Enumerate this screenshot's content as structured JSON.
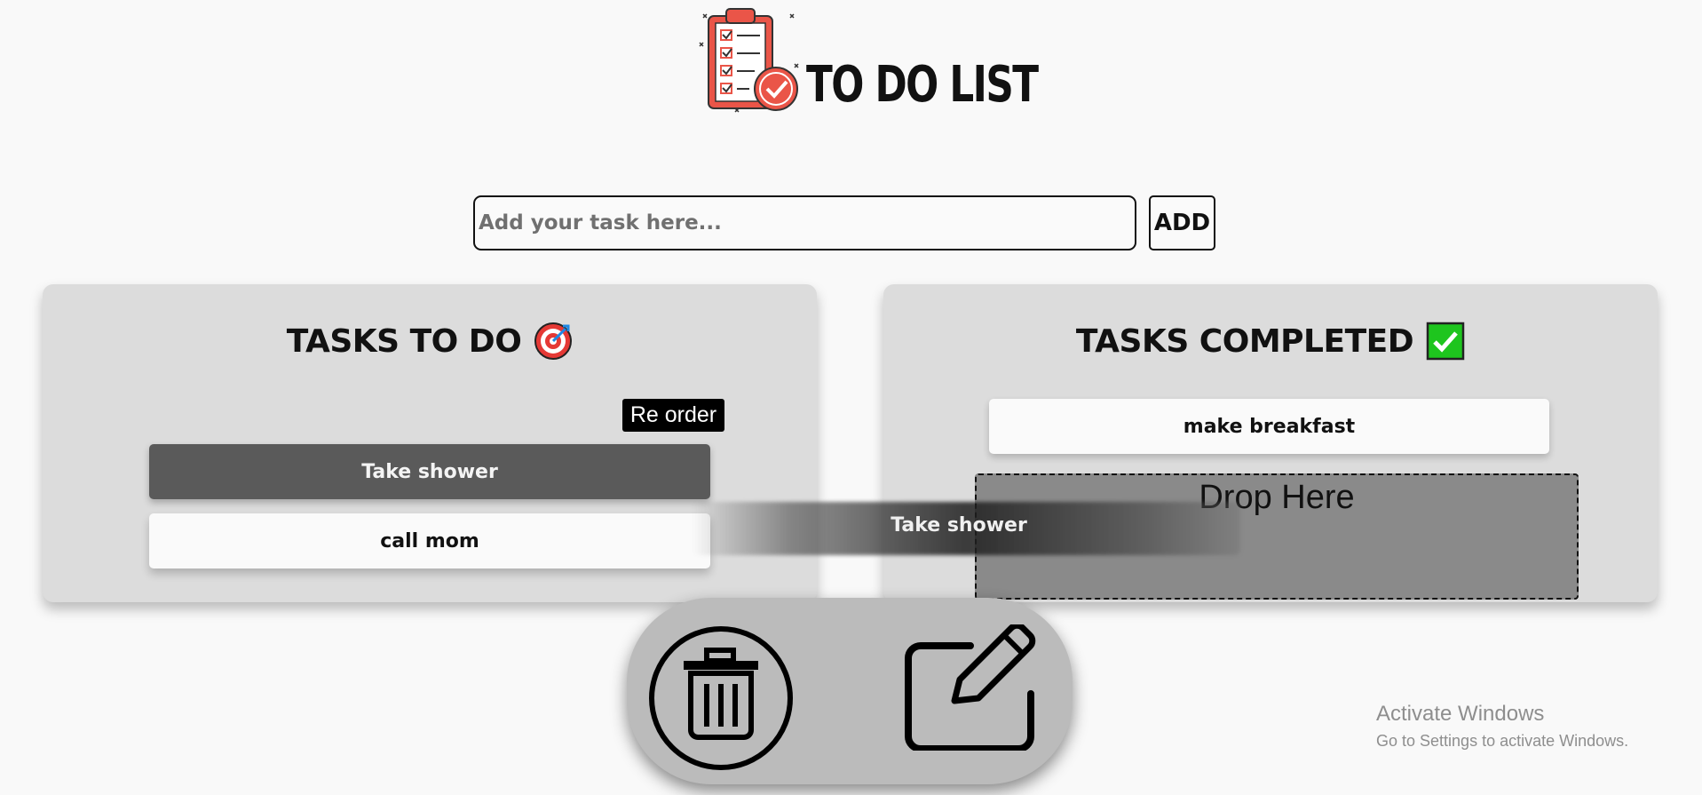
{
  "header": {
    "title": "TO DO LIST",
    "logo_icon": "clipboard-checklist-icon"
  },
  "input": {
    "placeholder": "Add your task here...",
    "value": "",
    "add_label": "ADD"
  },
  "todo_panel": {
    "title": "TASKS TO DO",
    "title_icon": "target-icon",
    "reorder_label": "Re order",
    "tasks": [
      {
        "label": "Take shower",
        "state": "dragging"
      },
      {
        "label": "call mom",
        "state": "normal"
      }
    ]
  },
  "done_panel": {
    "title": "TASKS COMPLETED",
    "title_icon": "check-mark-icon",
    "tasks": [
      {
        "label": "make breakfast"
      }
    ],
    "drop_label": "Drop Here"
  },
  "drag_ghost": {
    "label": "Take shower"
  },
  "actions": {
    "delete_icon": "trash-icon",
    "edit_icon": "edit-icon"
  },
  "watermark": {
    "title": "Activate Windows",
    "subtitle": "Go to Settings to activate Windows."
  },
  "colors": {
    "background": "#f9f9f9",
    "panel": "#dcdcdc",
    "dragging_task": "#5a5a5a",
    "drop_zone": "#8a8a8a",
    "check_green": "#1ec51e",
    "logo_red": "#ea5548"
  }
}
